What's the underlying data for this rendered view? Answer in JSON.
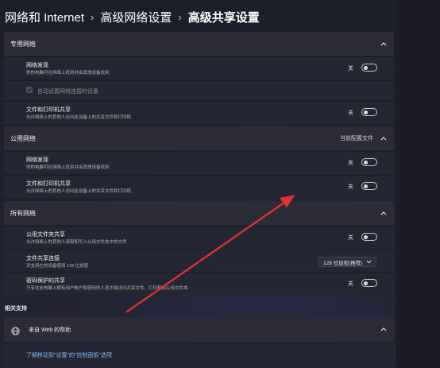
{
  "breadcrumb": {
    "item1": "网络和 Internet",
    "item2": "高级网络设置",
    "item3": "高级共享设置"
  },
  "private": {
    "title": "专用网络",
    "discovery_title": "网络发现",
    "discovery_desc": "你的电脑可在网络上找到并由其他设备找到",
    "discovery_state": "关",
    "auto_setup_label": "自动设置网络连接的设备",
    "file_share_title": "文件和打印机共享",
    "file_share_desc": "允许网络上的其他人访问此设备上的共享文件和打印机",
    "file_share_state": "关"
  },
  "public": {
    "title": "公用网络",
    "status": "当前配置文件",
    "discovery_title": "网络发现",
    "discovery_desc": "你的电脑可在网络上找到并由其他设备找到",
    "discovery_state": "关",
    "file_share_title": "文件和打印机共享",
    "file_share_desc": "允许网络上的其他人访问此设备上的共享文件和打印机",
    "file_share_state": "关"
  },
  "all": {
    "title": "所有网络",
    "public_folder_title": "公用文件夹共享",
    "public_folder_desc": "允许网络上的其他人读取和写入公用文件夹中的文件",
    "public_folder_state": "关",
    "connection_title": "文件共享连接",
    "connection_desc": "对支持它的设备使用 128 位加密",
    "connection_value": "128 位加密(推荐)",
    "password_title": "密码保护的共享",
    "password_desc": "只有在此电脑上拥有用户帐户和密码的人员才能访问共享文件、打印机和公用文件夹",
    "password_state": "关"
  },
  "related": {
    "title": "相关支持",
    "help_title": "来自 Web 的帮助",
    "help_link": "了解移动到\"设置\"的\"控制面板\"选项"
  },
  "colors": {
    "arrow": "#e0322e",
    "link": "#7fb7f0"
  }
}
